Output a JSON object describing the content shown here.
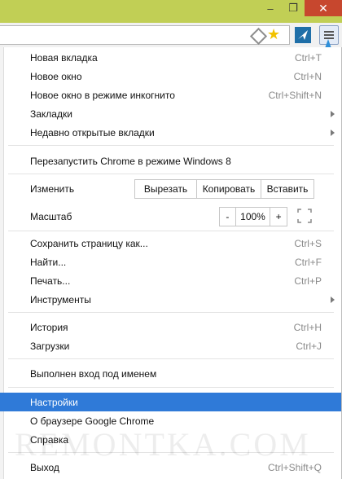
{
  "window": {
    "minimize_glyph": "–",
    "maximize_glyph": "❐",
    "close_glyph": "✕",
    "frame_color": "#c1cf55"
  },
  "toolbar": {
    "star_glyph": "★",
    "accent": "#2f7ad8"
  },
  "menu": {
    "items": [
      {
        "label": "Новая вкладка",
        "shortcut": "Ctrl+T"
      },
      {
        "label": "Новое окно",
        "shortcut": "Ctrl+N"
      },
      {
        "label": "Новое окно в режиме инкогнито",
        "shortcut": "Ctrl+Shift+N"
      },
      {
        "label": "Закладки",
        "submenu": true
      },
      {
        "label": "Недавно открытые вкладки",
        "submenu": true
      },
      {
        "label": "Перезапустить Chrome в режиме Windows 8"
      },
      {
        "label": "Сохранить страницу как...",
        "shortcut": "Ctrl+S"
      },
      {
        "label": "Найти...",
        "shortcut": "Ctrl+F"
      },
      {
        "label": "Печать...",
        "shortcut": "Ctrl+P"
      },
      {
        "label": "Инструменты",
        "submenu": true
      },
      {
        "label": "История",
        "shortcut": "Ctrl+H"
      },
      {
        "label": "Загрузки",
        "shortcut": "Ctrl+J"
      },
      {
        "label": "Выполнен вход под именем"
      },
      {
        "label": "Настройки",
        "highlighted": true
      },
      {
        "label": "О браузере Google Chrome"
      },
      {
        "label": "Справка"
      },
      {
        "label": "Выход",
        "shortcut": "Ctrl+Shift+Q"
      }
    ],
    "edit": {
      "label": "Изменить",
      "cut": "Вырезать",
      "copy": "Копировать",
      "paste": "Вставить"
    },
    "zoom": {
      "label": "Масштаб",
      "minus": "-",
      "value": "100%",
      "plus": "+"
    }
  },
  "watermark": "REMONTKA.COM"
}
